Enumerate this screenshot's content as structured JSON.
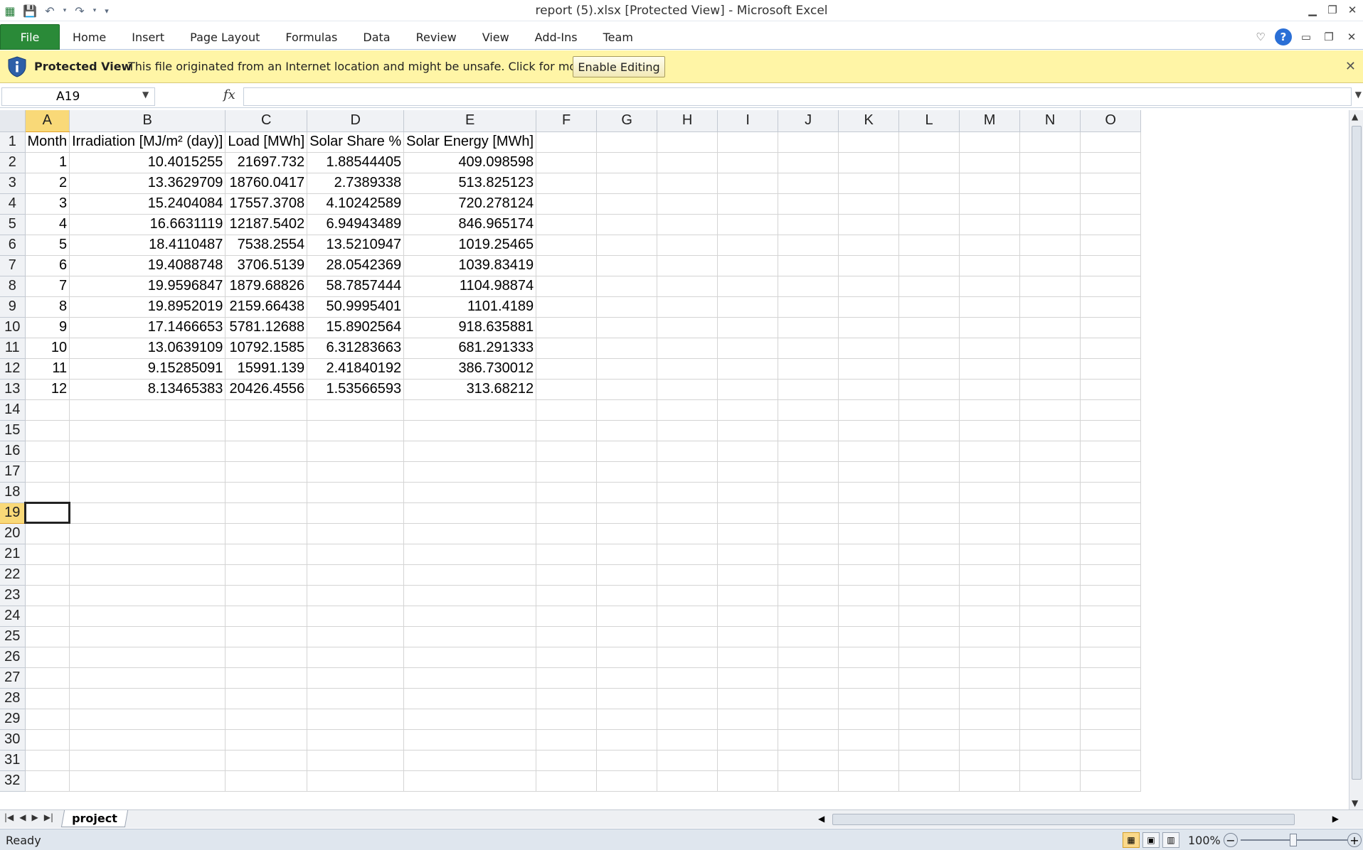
{
  "window": {
    "title": "report (5).xlsx  [Protected View]  -  Microsoft Excel"
  },
  "ribbon": {
    "file_label": "File",
    "tabs": [
      "Home",
      "Insert",
      "Page Layout",
      "Formulas",
      "Data",
      "Review",
      "View",
      "Add-Ins",
      "Team"
    ]
  },
  "protected_view": {
    "title": "Protected View",
    "message": "This file originated from an Internet location and might be unsafe. Click for more details.",
    "button_label": "Enable Editing"
  },
  "formula_bar": {
    "name_box": "A19",
    "fx_label": "fx",
    "formula": ""
  },
  "sheet": {
    "columns": [
      "A",
      "B",
      "C",
      "D",
      "E",
      "F",
      "G",
      "H",
      "I",
      "J",
      "K",
      "L",
      "M",
      "N",
      "O"
    ],
    "headers": [
      "Month",
      "Irradiation [MJ/m² (day)]",
      "Load [MWh]",
      "Solar Share %",
      "Solar Energy [MWh]"
    ],
    "rows": [
      [
        "1",
        "10.4015255",
        "21697.732",
        "1.88544405",
        "409.098598"
      ],
      [
        "2",
        "13.3629709",
        "18760.0417",
        "2.7389338",
        "513.825123"
      ],
      [
        "3",
        "15.2404084",
        "17557.3708",
        "4.10242589",
        "720.278124"
      ],
      [
        "4",
        "16.6631119",
        "12187.5402",
        "6.94943489",
        "846.965174"
      ],
      [
        "5",
        "18.4110487",
        "7538.2554",
        "13.5210947",
        "1019.25465"
      ],
      [
        "6",
        "19.4088748",
        "3706.5139",
        "28.0542369",
        "1039.83419"
      ],
      [
        "7",
        "19.9596847",
        "1879.68826",
        "58.7857444",
        "1104.98874"
      ],
      [
        "8",
        "19.8952019",
        "2159.66438",
        "50.9995401",
        "1101.4189"
      ],
      [
        "9",
        "17.1466653",
        "5781.12688",
        "15.8902564",
        "918.635881"
      ],
      [
        "10",
        "13.0639109",
        "10792.1585",
        "6.31283663",
        "681.291333"
      ],
      [
        "11",
        "9.15285091",
        "15991.139",
        "2.41840192",
        "386.730012"
      ],
      [
        "12",
        "8.13465383",
        "20426.4556",
        "1.53566593",
        "313.68212"
      ]
    ],
    "total_rows": 32,
    "active_cell": {
      "col": "A",
      "row": 19
    },
    "tab_name": "project"
  },
  "status": {
    "text": "Ready",
    "zoom": "100%"
  },
  "colors": {
    "file_tab": "#2a8a38",
    "protected_bar": "#fff5a6",
    "selected_header": "#f9d978"
  }
}
